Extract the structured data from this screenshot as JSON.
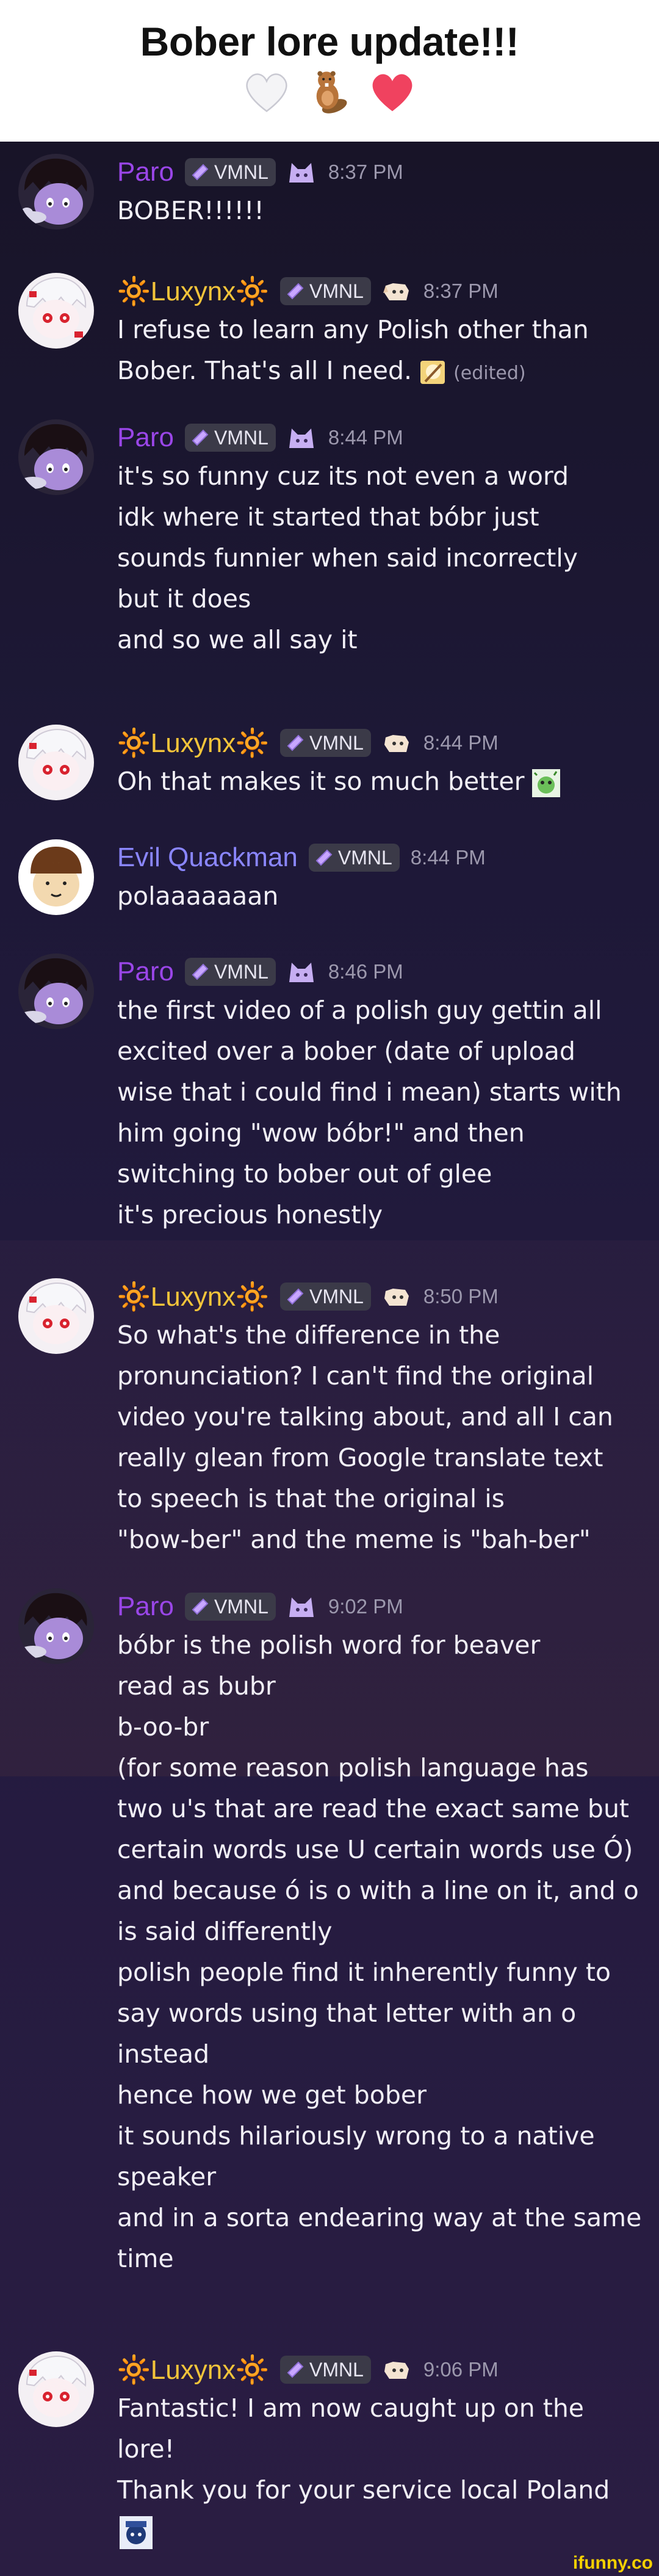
{
  "header": {
    "title": "Bober lore update!!!",
    "emojis": [
      "white-heart-icon",
      "beaver-icon",
      "pink-heart-icon"
    ]
  },
  "role_tag": "VMNL",
  "messages": [
    {
      "author": "Paro",
      "time": "8:37 PM",
      "lines": [
        "BOBER!!!!!!"
      ]
    },
    {
      "author": "🔆Luxynx🔆",
      "time": "8:37 PM",
      "lines": [
        "I refuse to learn any Polish other than",
        "Bober. That's all I need."
      ],
      "edited": "(edited)"
    },
    {
      "author": "Paro",
      "time": "8:44 PM",
      "lines": [
        "it's so funny cuz its not even a word",
        "idk where it started that bóbr just",
        "sounds funnier when said incorrectly",
        "but it does",
        "and so we all say it"
      ]
    },
    {
      "author": "🔆Luxynx🔆",
      "time": "8:44 PM",
      "lines": [
        "Oh that makes it so much better"
      ]
    },
    {
      "author": "Evil Quackman",
      "time": "8:44 PM",
      "lines": [
        "polaaaaaaan"
      ]
    },
    {
      "author": "Paro",
      "time": "8:46 PM",
      "lines": [
        "the first video of a polish guy gettin all",
        "excited over a bober (date of upload",
        "wise that i could find i mean) starts with",
        "him going \"wow bóbr!\" and then",
        "switching to bober out of glee",
        "it's precious honestly"
      ]
    },
    {
      "author": "🔆Luxynx🔆",
      "time": "8:50 PM",
      "lines": [
        "So what's the difference in the",
        "pronunciation? I can't find the original",
        "video you're talking about, and all I can",
        "really glean from Google translate text",
        "to speech is that the original is",
        "\"bow-ber\" and the meme is \"bah-ber\""
      ]
    },
    {
      "author": "Paro",
      "time": "9:02 PM",
      "lines": [
        "bóbr is the polish word for beaver",
        "read as bubr",
        "b-oo-br",
        "(for some reason polish language has",
        "two u's that are read the exact same but",
        "certain words use U certain words use Ó)",
        "and because ó is o with a line on it, and o",
        "is said differently",
        "polish people find it inherently funny to",
        "say words using that letter with an o",
        "instead",
        "hence how we get bober",
        "it sounds hilariously wrong to a native",
        "speaker",
        "and in a sorta endearing way at the same",
        "time"
      ]
    },
    {
      "author": "🔆Luxynx🔆",
      "time": "9:06 PM",
      "lines": [
        "Fantastic! I am now caught up on the",
        "lore!",
        "Thank you for your service local Poland"
      ]
    }
  ],
  "watermark": "ifunny.co"
}
